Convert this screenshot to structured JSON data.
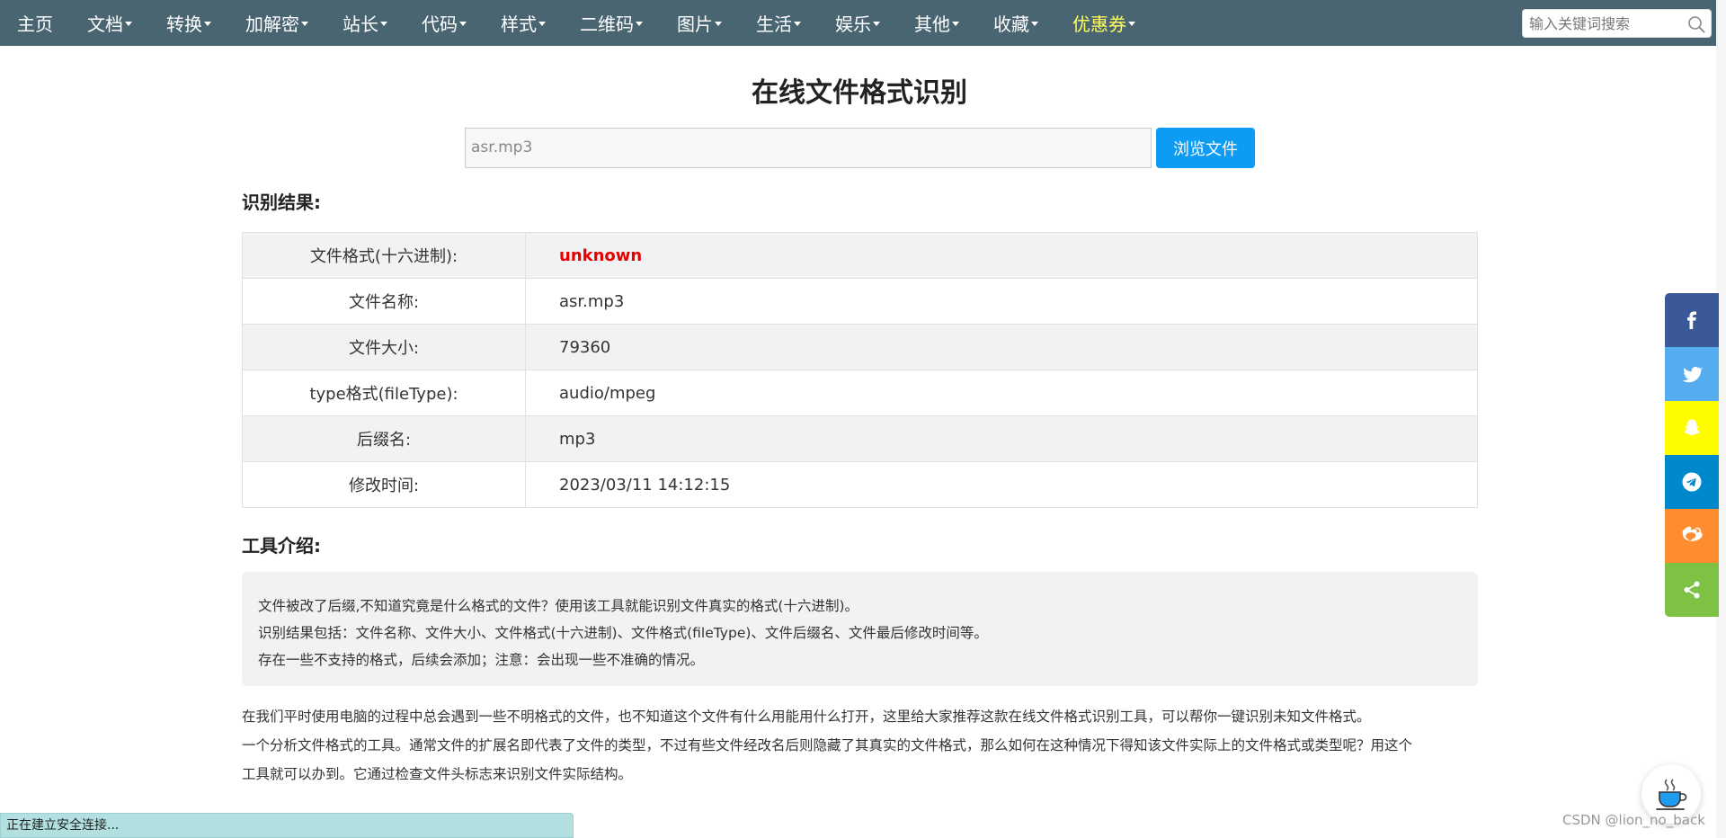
{
  "nav": {
    "items": [
      {
        "label": "主页",
        "caret": false
      },
      {
        "label": "文档",
        "caret": true
      },
      {
        "label": "转换",
        "caret": true
      },
      {
        "label": "加解密",
        "caret": true
      },
      {
        "label": "站长",
        "caret": true
      },
      {
        "label": "代码",
        "caret": true
      },
      {
        "label": "样式",
        "caret": true
      },
      {
        "label": "二维码",
        "caret": true
      },
      {
        "label": "图片",
        "caret": true
      },
      {
        "label": "生活",
        "caret": true
      },
      {
        "label": "娱乐",
        "caret": true
      },
      {
        "label": "其他",
        "caret": true
      },
      {
        "label": "收藏",
        "caret": true
      },
      {
        "label": "优惠券",
        "caret": true,
        "highlight": true
      }
    ],
    "search_placeholder": "输入关键词搜索"
  },
  "main": {
    "title": "在线文件格式识别",
    "file_value": "asr.mp3",
    "browse_label": "浏览文件",
    "result_heading": "识别结果:",
    "results": [
      {
        "key": "文件格式(十六进制):",
        "value": "unknown",
        "red": true
      },
      {
        "key": "文件名称:",
        "value": "asr.mp3"
      },
      {
        "key": "文件大小:",
        "value": "79360"
      },
      {
        "key": "type格式(fileType):",
        "value": "audio/mpeg"
      },
      {
        "key": "后缀名:",
        "value": "mp3"
      },
      {
        "key": "修改时间:",
        "value": "2023/03/11 14:12:15"
      }
    ],
    "intro_heading": "工具介绍:",
    "intro_lines": [
      "文件被改了后缀,不知道究竟是什么格式的文件？使用该工具就能识别文件真实的格式(十六进制)。",
      "识别结果包括：文件名称、文件大小、文件格式(十六进制)、文件格式(fileType)、文件后缀名、文件最后修改时间等。",
      "存在一些不支持的格式，后续会添加；注意：会出现一些不准确的情况。"
    ],
    "desc_lines": [
      "在我们平时使用电脑的过程中总会遇到一些不明格式的文件，也不知道这个文件有什么用能用什么打开，这里给大家推荐这款在线文件格式识别工具，可以帮你一键识别未知文件格式。",
      "一个分析文件格式的工具。通常文件的扩展名即代表了文件的类型，不过有些文件经改名后则隐藏了其真实的文件格式，那么如何在这种情况下得知该文件实际上的文件格式或类型呢？用这个",
      "工具就可以办到。它通过检查文件头标志来识别文件实际结构。"
    ]
  },
  "share": [
    {
      "name": "facebook-icon",
      "color": "#3b5998"
    },
    {
      "name": "twitter-icon",
      "color": "#55acee"
    },
    {
      "name": "snapchat-icon",
      "color": "#fffc00"
    },
    {
      "name": "telegram-icon",
      "color": "#0088cc"
    },
    {
      "name": "weibo-icon",
      "color": "#ff8c2f"
    },
    {
      "name": "share-icon",
      "color": "#7dc242"
    }
  ],
  "watermark": "CSDN @lion_no_back",
  "status_text": "正在建立安全连接..."
}
